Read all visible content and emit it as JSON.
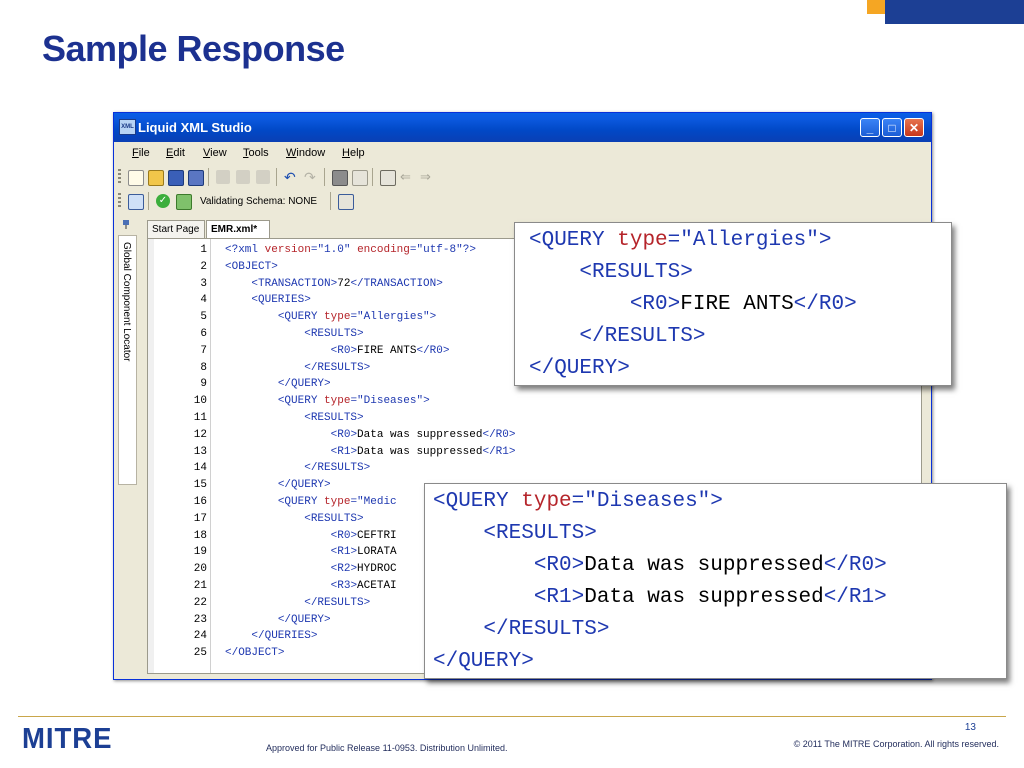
{
  "slide": {
    "title": "Sample Response",
    "page_number": "13",
    "footer_approved": "Approved for Public Release 11-0953. Distribution Unlimited.",
    "footer_copyright": "© 2011 The MITRE Corporation. All rights reserved.",
    "logo_text": "MITRE",
    "colors": {
      "title": "#1c3190",
      "brand_blue": "#1c3f94",
      "accent_orange": "#f5a623"
    }
  },
  "window": {
    "title": "Liquid XML Studio",
    "app_icon_label": "XML",
    "controls": {
      "minimize": "_",
      "maximize": "□",
      "close": "✕"
    },
    "menu": [
      {
        "label": "File",
        "key": "F",
        "rest": "ile"
      },
      {
        "label": "Edit",
        "key": "E",
        "rest": "dit"
      },
      {
        "label": "View",
        "key": "V",
        "rest": "iew"
      },
      {
        "label": "Tools",
        "key": "T",
        "rest": "ools"
      },
      {
        "label": "Window",
        "key": "W",
        "rest": "indow"
      },
      {
        "label": "Help",
        "key": "H",
        "rest": "elp"
      }
    ],
    "toolbar_icons": [
      "new-file-icon",
      "open-folder-icon",
      "save-icon",
      "save-all-icon",
      "cut-icon",
      "copy-icon",
      "paste-icon",
      "undo-icon",
      "redo-icon",
      "print-icon",
      "print-preview-icon",
      "external-icon",
      "back-arrow-icon",
      "forward-arrow-icon"
    ],
    "schema_toolbar": {
      "status": "Validating Schema: NONE"
    },
    "side_panel": {
      "label": "Global Component Locator"
    },
    "tabs": [
      {
        "label": "Start Page",
        "active": false
      },
      {
        "label": "EMR.xml*",
        "active": true
      }
    ],
    "code_lines": [
      {
        "n": "1",
        "text": "<?xml version=\"1.0\" encoding=\"utf-8\"?>"
      },
      {
        "n": "2",
        "text": "<OBJECT>"
      },
      {
        "n": "3",
        "text": "    <TRANSACTION>72</TRANSACTION>"
      },
      {
        "n": "4",
        "text": "    <QUERIES>"
      },
      {
        "n": "5",
        "text": "        <QUERY type=\"Allergies\">"
      },
      {
        "n": "6",
        "text": "            <RESULTS>"
      },
      {
        "n": "7",
        "text": "                <R0>FIRE ANTS</R0>"
      },
      {
        "n": "8",
        "text": "            </RESULTS>"
      },
      {
        "n": "9",
        "text": "        </QUERY>"
      },
      {
        "n": "10",
        "text": "        <QUERY type=\"Diseases\">"
      },
      {
        "n": "11",
        "text": "            <RESULTS>"
      },
      {
        "n": "12",
        "text": "                <R0>Data was suppressed</R0>"
      },
      {
        "n": "13",
        "text": "                <R1>Data was suppressed</R1>"
      },
      {
        "n": "14",
        "text": "            </RESULTS>"
      },
      {
        "n": "15",
        "text": "        </QUERY>"
      },
      {
        "n": "16",
        "text": "        <QUERY type=\"Medic"
      },
      {
        "n": "17",
        "text": "            <RESULTS>"
      },
      {
        "n": "18",
        "text": "                <R0>CEFTRI"
      },
      {
        "n": "19",
        "text": "                <R1>LORATA"
      },
      {
        "n": "20",
        "text": "                <R2>HYDROC"
      },
      {
        "n": "21",
        "text": "                <R3>ACETAI"
      },
      {
        "n": "22",
        "text": "            </RESULTS>"
      },
      {
        "n": "23",
        "text": "        </QUERY>"
      },
      {
        "n": "24",
        "text": "    </QUERIES>"
      },
      {
        "n": "25",
        "text": "</OBJECT>"
      }
    ]
  },
  "callout_allergies": {
    "lines": [
      "<QUERY type=\"Allergies\">",
      "    <RESULTS>",
      "        <R0>FIRE ANTS</R0>",
      "    </RESULTS>",
      "</QUERY>"
    ]
  },
  "callout_diseases": {
    "lines": [
      "<QUERY type=\"Diseases\">",
      "    <RESULTS>",
      "        <R0>Data was suppressed</R0>",
      "        <R1>Data was suppressed</R1>",
      "    </RESULTS>",
      "</QUERY>"
    ]
  }
}
